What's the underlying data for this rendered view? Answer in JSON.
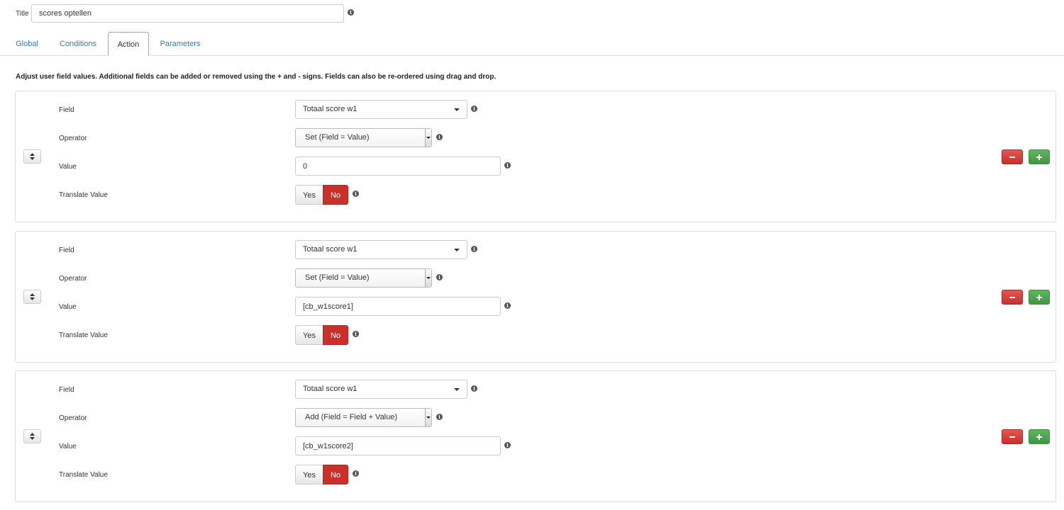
{
  "title": {
    "label": "Title",
    "value": "scores optellen",
    "info_icon": "info-circle-icon"
  },
  "tabs": [
    {
      "label": "Global",
      "active": false
    },
    {
      "label": "Conditions",
      "active": false
    },
    {
      "label": "Action",
      "active": true
    },
    {
      "label": "Parameters",
      "active": false
    }
  ],
  "intro_text": "Adjust user field values. Additional fields can be added or removed using the + and - signs. Fields can also be re-ordered using drag and drop.",
  "labels": {
    "field": "Field",
    "operator": "Operator",
    "value": "Value",
    "translate": "Translate Value"
  },
  "toggle": {
    "yes": "Yes",
    "no": "No",
    "selected": "No"
  },
  "icons": {
    "drag": "sort-updown-icon",
    "info": "info-circle-icon",
    "remove": "minus-icon",
    "add": "plus-icon"
  },
  "colors": {
    "link": "#337ab7",
    "danger": "#c9302c",
    "success": "#4cae4c"
  },
  "rows": [
    {
      "field": "Totaal score w1",
      "operator": "Set (Field = Value)",
      "value": "0",
      "translate": "No"
    },
    {
      "field": "Totaal score w1",
      "operator": "Set (Field = Value)",
      "value": "[cb_w1score1]",
      "translate": "No"
    },
    {
      "field": "Totaal score w1",
      "operator": "Add (Field = Field + Value)",
      "value": "[cb_w1score2]",
      "translate": "No"
    }
  ]
}
